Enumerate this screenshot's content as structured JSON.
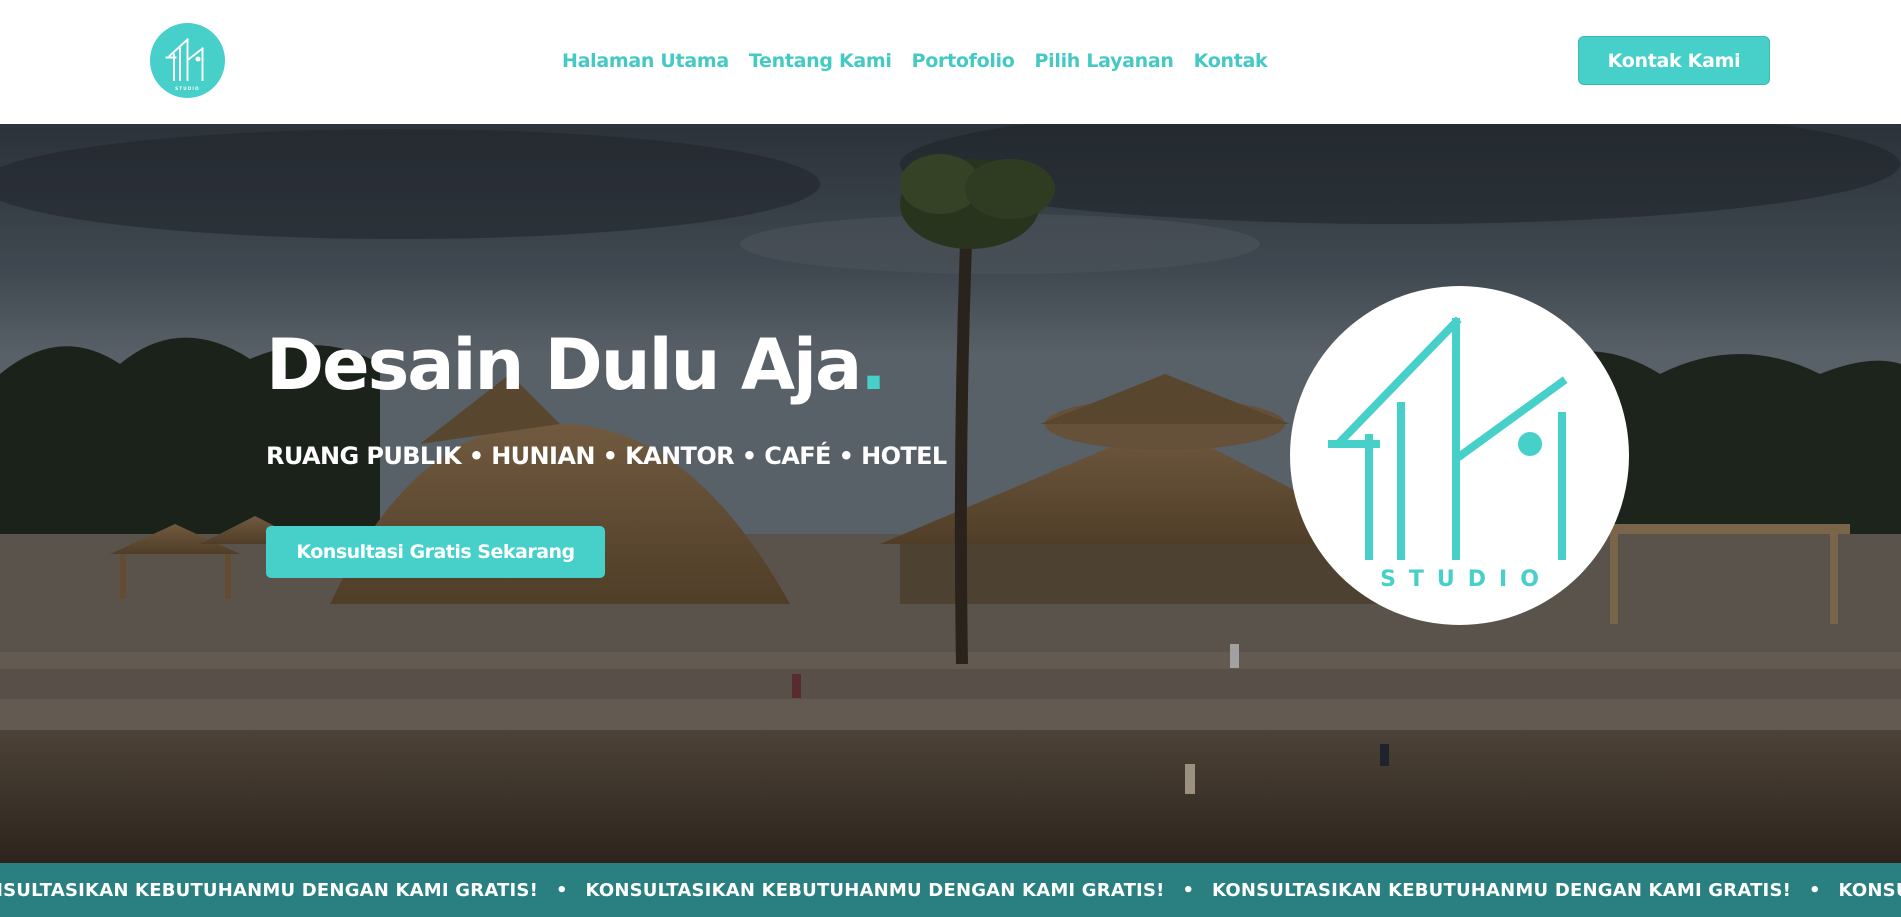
{
  "header": {
    "logo_text": "STUDIO",
    "nav": [
      {
        "label": "Halaman Utama"
      },
      {
        "label": "Tentang Kami"
      },
      {
        "label": "Portofolio"
      },
      {
        "label": "Pilih Layanan"
      },
      {
        "label": "Kontak"
      }
    ],
    "cta_label": "Kontak Kami"
  },
  "hero": {
    "title": "Desain Dulu Aja",
    "title_dot": ".",
    "subtitle": "RUANG PUBLIK • HUNIAN • KANTOR • CAFÉ • HOTEL",
    "cta_label": "Konsultasi Gratis Sekarang",
    "logo_text": "STUDIO"
  },
  "marquee": {
    "text": "KONSULTASIKAN KEBUTUHANMU DENGAN KAMI GRATIS!",
    "separator": "•"
  },
  "colors": {
    "accent": "#47cfca",
    "marquee_bg": "#2a7f80",
    "white": "#ffffff"
  },
  "icons": {
    "brand_logo": "fm-studio-logo"
  }
}
